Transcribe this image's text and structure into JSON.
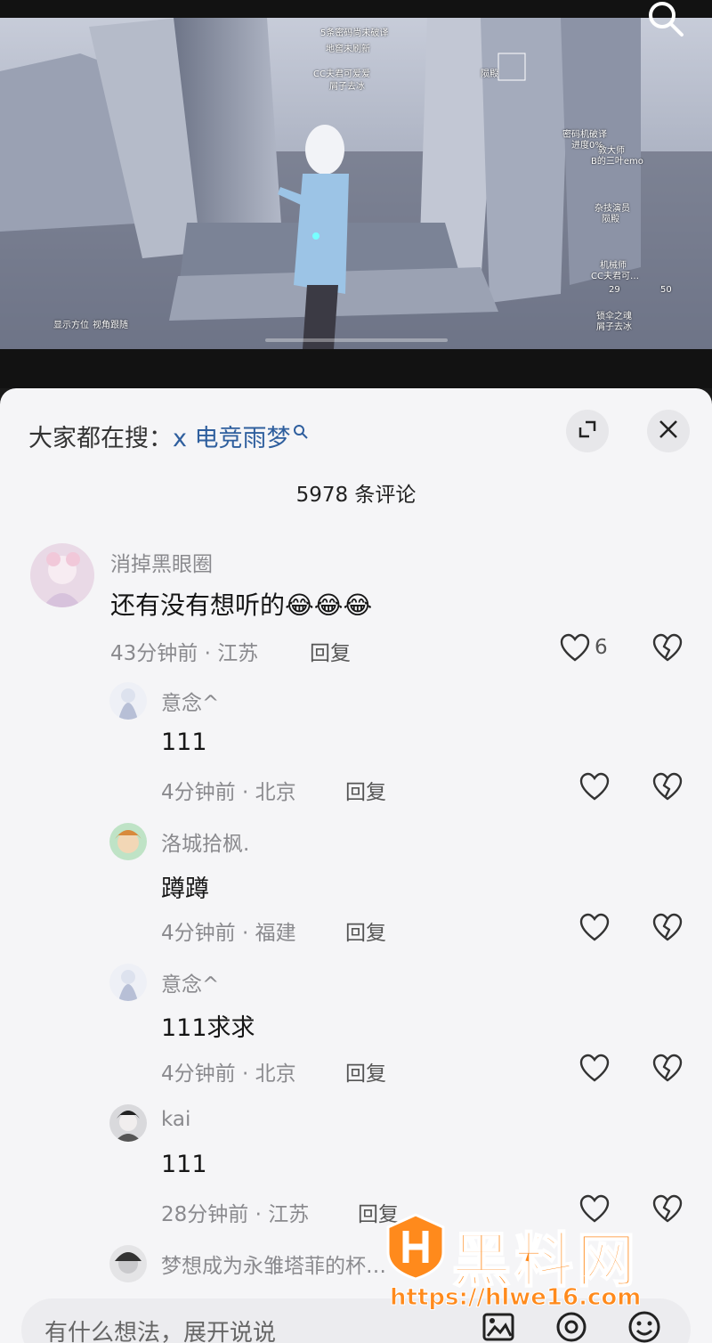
{
  "video": {
    "progress": 0.0,
    "hud_texts": [
      "5条密码尚未破译",
      "地窖未刷新",
      "CC夫君可爱爱",
      "屑子去冰",
      "陨殿",
      "密码机破译",
      "进度0%",
      "敦大师",
      "B的三叶emo",
      "杂技演员",
      "陨殿",
      "机械师",
      "CC夫君可…",
      "显示方位",
      "视角跟随",
      "锁伞之魂",
      "屑子去冰",
      "29",
      "50"
    ]
  },
  "sheet": {
    "hot_search_prefix": "大家都在搜：",
    "hot_search_keyword": "x 电竞雨梦",
    "comment_count": "5978 条评论"
  },
  "comments": [
    {
      "username": "消掉黑眼圈",
      "text": "还有没有想听的",
      "emoji": "😂😂😂",
      "time": "43分钟前 · 江苏",
      "reply": "回复",
      "likes": "6"
    },
    {
      "username": "意念^",
      "text": "111",
      "time": "4分钟前 · 北京",
      "reply": "回复"
    },
    {
      "username": "洛城拾枫.",
      "text": "蹲蹲",
      "time": "4分钟前 · 福建",
      "reply": "回复"
    },
    {
      "username": "意念^",
      "text": "111求求",
      "time": "4分钟前 · 北京",
      "reply": "回复"
    },
    {
      "username": "kai",
      "text": "111",
      "time": "28分钟前 · 江苏",
      "reply": "回复"
    },
    {
      "username": "梦想成为永雏塔菲的杯…"
    }
  ],
  "input": {
    "placeholder": "有什么想法，展开说说"
  },
  "watermark": {
    "title": "黑料网",
    "url": "https://hlwe16.com"
  },
  "colors": {
    "sheet_bg": "#f5f5f7",
    "keyword": "#2f5f9e",
    "watermark": "#ff8a1c"
  },
  "icons": [
    "search-icon",
    "expand-icon",
    "close-icon",
    "heart-outline-icon",
    "broken-heart-icon",
    "image-icon",
    "at-icon",
    "emoji-icon"
  ]
}
